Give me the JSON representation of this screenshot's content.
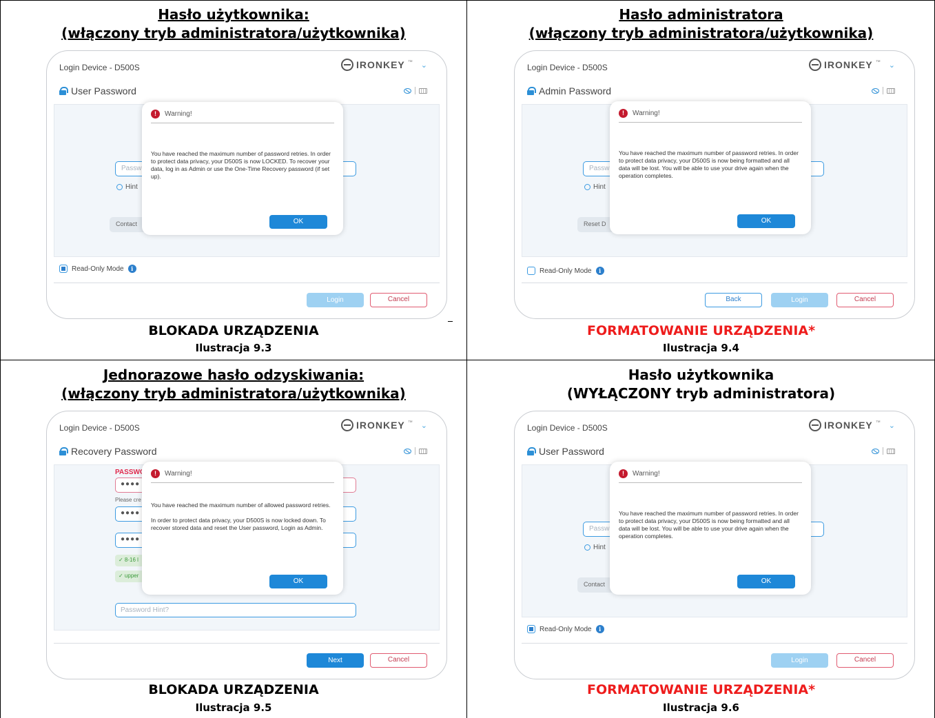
{
  "panels": [
    {
      "heading_line1": "Hasło użytkownika: ",
      "heading_line2": "(włączony tryb administratora/użytkownika)",
      "window_title": "Login Device - D500S",
      "logo_text": "IRONKEY",
      "password_title": "User Password",
      "input_placeholder": "Passw",
      "hint_label": "Hint",
      "side_button": "Contact",
      "read_only_label": "Read-Only Mode",
      "read_only_checked": true,
      "warning_title": "Warning!",
      "warning_text": "You have reached the maximum number of password retries. In order to protect data privacy, your D500S is now LOCKED. To recover your data, log in as Admin or use the One-Time Recovery password (if set up).",
      "ok_label": "OK",
      "login_label": "Login",
      "cancel_label": "Cancel",
      "status": "BLOKADA URZĄDZENIA",
      "figure": "Ilustracja 9.3"
    },
    {
      "heading_line1": "Hasło administratora ",
      "heading_line2": "(włączony tryb administratora/użytkownika)",
      "window_title": "Login Device - D500S",
      "logo_text": "IRONKEY",
      "password_title": "Admin Password",
      "input_placeholder": "Passw",
      "hint_label": "Hint",
      "side_button": "Reset D",
      "read_only_label": "Read-Only Mode",
      "read_only_checked": false,
      "warning_title": "Warning!",
      "warning_text": "You have reached the maximum number of password retries. In order to protect data privacy, your D500S is now being formatted and all data will be lost. You will be able to use your drive again when the operation completes.",
      "ok_label": "OK",
      "back_label": "Back",
      "login_label": "Login",
      "cancel_label": "Cancel",
      "status": "FORMATOWANIE URZĄDZENIA*",
      "figure": "Ilustracja 9.4"
    },
    {
      "heading_line1": "Jednorazowe hasło odzyskiwania: ",
      "heading_line2": "(włączony tryb administratora/użytkownika)",
      "window_title": "Login Device - D500S",
      "logo_text": "IRONKEY",
      "password_title": "Recovery Password",
      "field_label": "PASSWO",
      "masked_value": "●●●●",
      "please_text": "Please cre",
      "check1": "✓ 8-16 l",
      "check2": "✓ upper",
      "hint_placeholder": "Password Hint?",
      "warning_title": "Warning!",
      "warning_text": "You have reached the maximum number of allowed password retries.\n\nIn order to protect data privacy, your D500S is now locked down. To recover stored data and reset the User password, Login as Admin.",
      "ok_label": "OK",
      "next_label": "Next",
      "cancel_label": "Cancel",
      "status": "BLOKADA URZĄDZENIA",
      "figure": "Ilustracja 9.5"
    },
    {
      "heading_line1": "Hasło użytkownika",
      "heading_line2": "(WYŁĄCZONY tryb administratora)",
      "window_title": "Login Device - D500S",
      "logo_text": "IRONKEY",
      "password_title": "User Password",
      "input_placeholder": "Passw",
      "hint_label": "Hint",
      "side_button": "Contact",
      "read_only_label": "Read-Only Mode",
      "read_only_checked": true,
      "warning_title": "Warning!",
      "warning_text": "You have reached the maximum number of password retries. In order to protect data privacy, your D500S is now being formatted and all data will be lost. You will be able to use your drive again when the operation completes.",
      "ok_label": "OK",
      "login_label": "Login",
      "cancel_label": "Cancel",
      "status": "FORMATOWANIE URZĄDZENIA*",
      "figure": "Ilustracja 9.6"
    }
  ],
  "colors": {
    "accent": "#1e88d8",
    "warning_red": "#c41a2e",
    "status_red": "#ee1c1c",
    "cancel_border": "#e05a70"
  },
  "icons": [
    "lock-icon",
    "eye-icon",
    "keyboard-icon",
    "warning-icon",
    "info-icon",
    "ironkey-logo"
  ]
}
